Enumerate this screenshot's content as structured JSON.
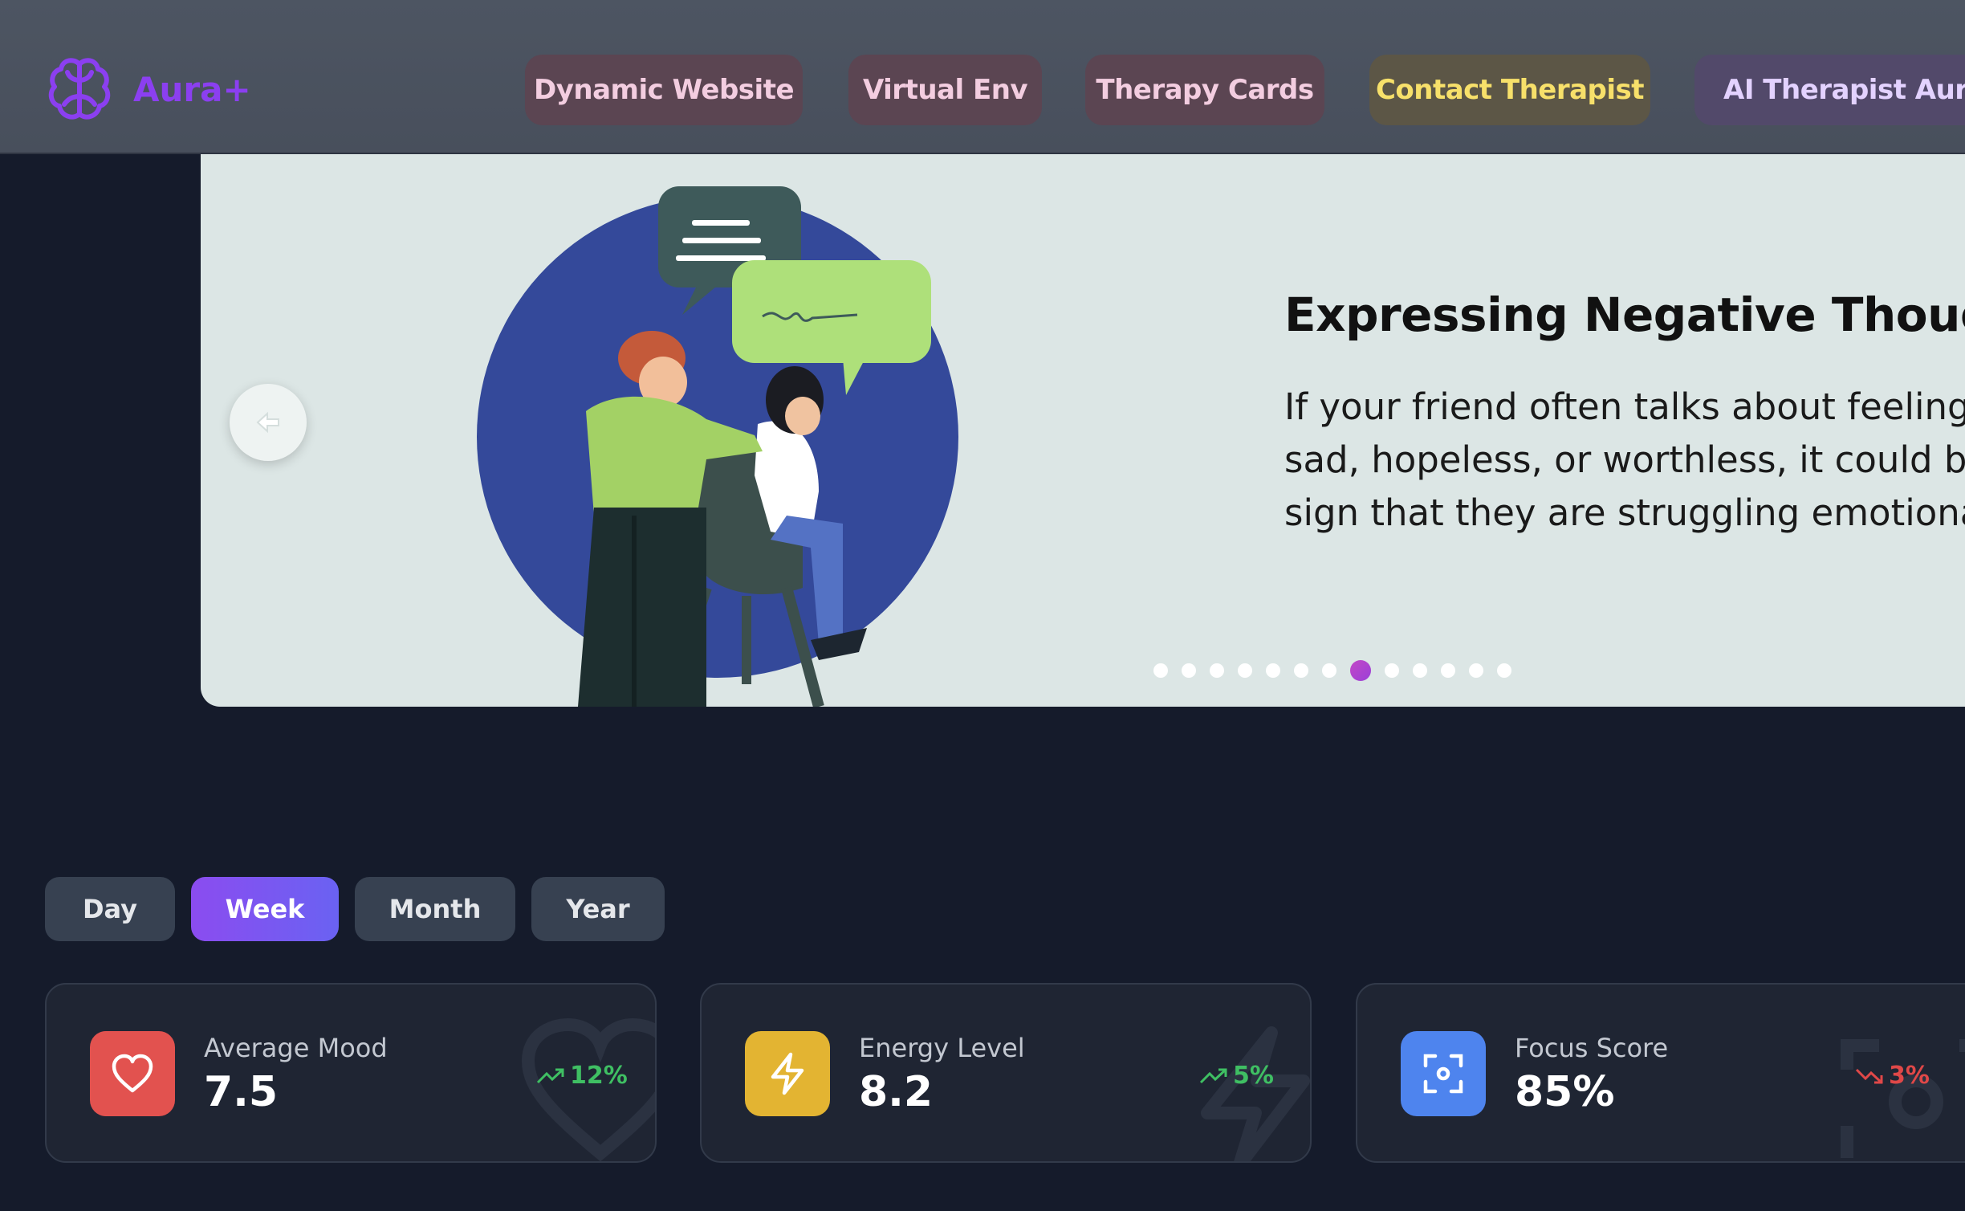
{
  "app": {
    "name": "Aura+",
    "accent_color": "#8b3ff0",
    "logo_icon": "brain-icon"
  },
  "nav": {
    "items": [
      {
        "label": "Dynamic Website"
      },
      {
        "label": "Virtual Env"
      },
      {
        "label": "Therapy Cards"
      },
      {
        "label": "Contact Therapist"
      },
      {
        "label": "AI Therapist Aura"
      }
    ]
  },
  "carousel": {
    "prev_icon": "arrow-left-icon",
    "slide": {
      "title": "Expressing Negative Though",
      "body": "If your friend often talks about feeling sad, hopeless, or worthless, it could b sign that they are struggling emotiona"
    },
    "total_slides": 13,
    "active_slide": 8
  },
  "periods": {
    "options": [
      "Day",
      "Week",
      "Month",
      "Year"
    ],
    "selected": "Week"
  },
  "stats": [
    {
      "label": "Average Mood",
      "value": "7.5",
      "trend": "12%",
      "trend_dir": "up",
      "icon": "heart-icon",
      "color": "#e2524f"
    },
    {
      "label": "Energy Level",
      "value": "8.2",
      "trend": "5%",
      "trend_dir": "up",
      "icon": "lightning-icon",
      "color": "#e3b432"
    },
    {
      "label": "Focus Score",
      "value": "85%",
      "trend": "3%",
      "trend_dir": "down",
      "icon": "focus-icon",
      "color": "#4e84ee"
    }
  ]
}
